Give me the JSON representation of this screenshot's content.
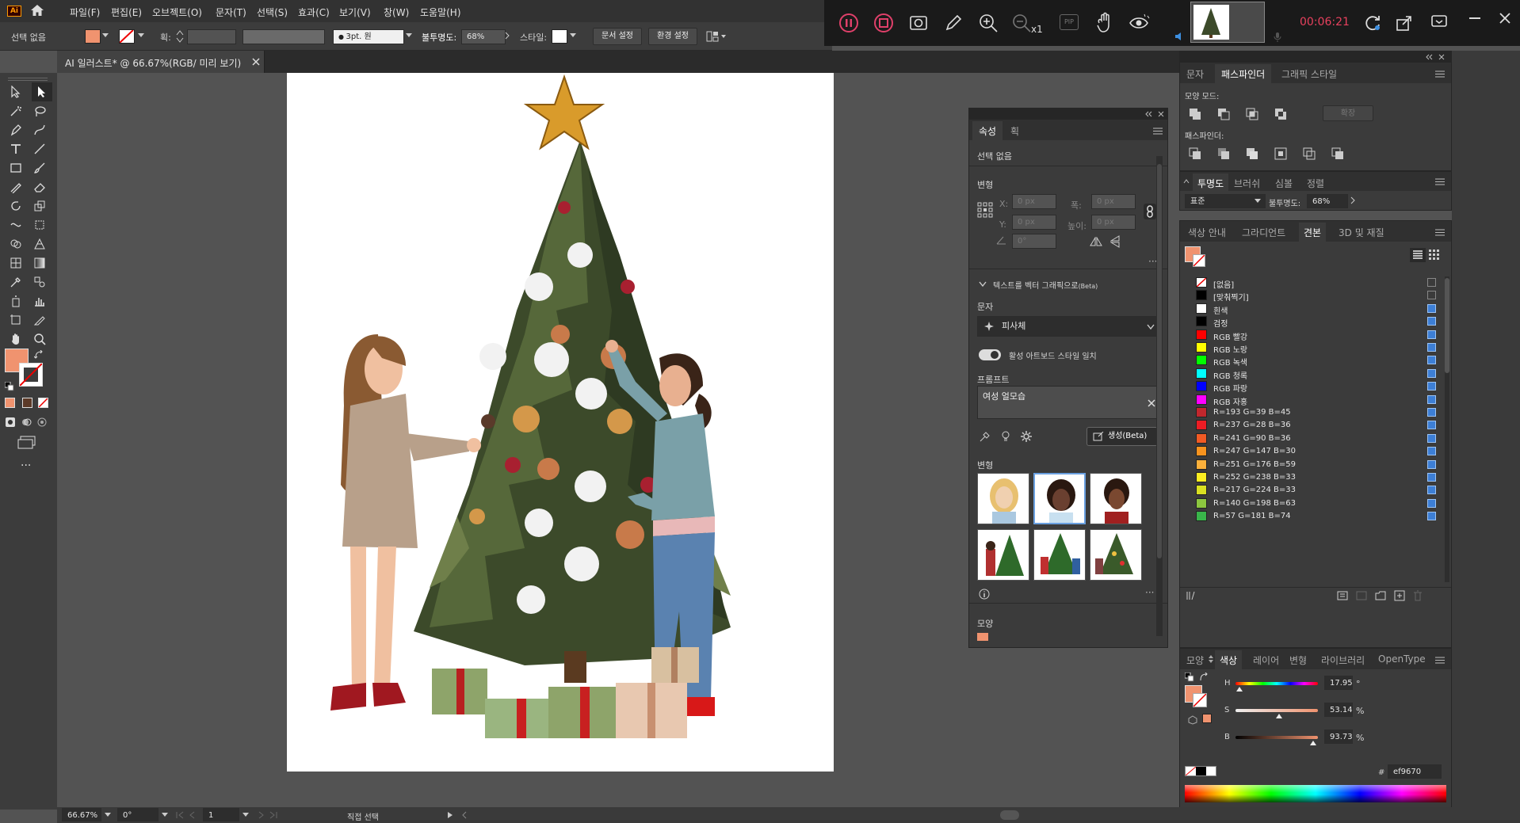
{
  "app": {
    "logo": "Ai"
  },
  "menu": [
    "파일(F)",
    "편집(E)",
    "오브젝트(O)",
    "문자(T)",
    "선택(S)",
    "효과(C)",
    "보기(V)",
    "창(W)",
    "도움말(H)"
  ],
  "control": {
    "selection": "선택 없음",
    "stroke_label": "획:",
    "brush_value": "3pt. 원",
    "opacity_label": "불투명도:",
    "opacity_value": "68%",
    "style_label": "스타일:",
    "doc_setup": "문서 설정",
    "prefs": "환경 설정",
    "fill_color": "#f0936f"
  },
  "recorder": {
    "timer": "00:06:21",
    "zoom": "x1",
    "pip": "PIP"
  },
  "document": {
    "tab_title": "AI 일러스트* @ 66.67%(RGB/ 미리 보기)"
  },
  "status": {
    "zoom": "66.67%",
    "angle": "0°",
    "page": "1",
    "tool": "직접 선택"
  },
  "properties": {
    "tabs": [
      "속성",
      "획"
    ],
    "selection": "선택 없음",
    "transform_title": "변형",
    "x_label": "X:",
    "y_label": "Y:",
    "w_label": "폭:",
    "h_label": "높이:",
    "x_value": "0 px",
    "y_value": "0 px",
    "w_value": "0 px",
    "h_value": "0 px",
    "angle_value": "0°",
    "t2v_title": "텍스트를 벡터 그래픽으로",
    "t2v_beta": "(Beta)",
    "type_label": "문자",
    "type_value": "피사체",
    "toggle_label": "활성 아트보드 스타일 일치",
    "prompt_label": "프롬프트",
    "prompt_value": "여성 얼모습",
    "generate": "생성(Beta)",
    "variations_title": "변형",
    "appearance_title": "모양"
  },
  "pathfinder": {
    "tabs": [
      "문자",
      "패스파인더",
      "그래픽 스타일"
    ],
    "shape_modes": "모양 모드:",
    "expand": "확장",
    "pathfinders": "패스파인더:"
  },
  "transparency": {
    "tabs": [
      "투명도",
      "브러쉬",
      "심볼",
      "정렬"
    ],
    "mode": "표준",
    "opacity_label": "불투명도:",
    "opacity_value": "68%"
  },
  "swatches": {
    "tabs": [
      "색상 안내",
      "그라디언트",
      "견본",
      "3D 및 재질"
    ],
    "items": [
      {
        "name": "[없음]",
        "color": "none"
      },
      {
        "name": "[맞춰찍기]",
        "color": "#000000"
      },
      {
        "name": "흰색",
        "color": "#ffffff"
      },
      {
        "name": "검정",
        "color": "#000000"
      },
      {
        "name": "RGB 빨강",
        "color": "#ff0000"
      },
      {
        "name": "RGB 노랑",
        "color": "#ffff00"
      },
      {
        "name": "RGB 녹색",
        "color": "#00ff00"
      },
      {
        "name": "RGB 청록",
        "color": "#00ffff"
      },
      {
        "name": "RGB 파랑",
        "color": "#0000ff"
      },
      {
        "name": "RGB 자홍",
        "color": "#ff00ff"
      },
      {
        "name": "R=193 G=39 B=45",
        "color": "#c1272d"
      },
      {
        "name": "R=237 G=28 B=36",
        "color": "#ed1c24"
      },
      {
        "name": "R=241 G=90 B=36",
        "color": "#f15a24"
      },
      {
        "name": "R=247 G=147 B=30",
        "color": "#f7931e"
      },
      {
        "name": "R=251 G=176 B=59",
        "color": "#fbb03b"
      },
      {
        "name": "R=252 G=238 B=33",
        "color": "#fcee21"
      },
      {
        "name": "R=217 G=224 B=33",
        "color": "#d9e021"
      },
      {
        "name": "R=140 G=198 B=63",
        "color": "#8cc63f"
      },
      {
        "name": "R=57 G=181 B=74",
        "color": "#39b54a"
      }
    ]
  },
  "color": {
    "tabs": [
      "모양",
      "색상",
      "레이어",
      "변형",
      "라이브러리",
      "OpenType"
    ],
    "h_label": "H",
    "s_label": "S",
    "b_label": "B",
    "h_value": "17.95",
    "s_value": "53.14",
    "b_value": "93.73",
    "h_unit": "°",
    "s_unit": "%",
    "b_unit": "%",
    "hex": "ef9670",
    "h_level": 0.05,
    "s_level": 0.53,
    "b_level": 0.94
  }
}
